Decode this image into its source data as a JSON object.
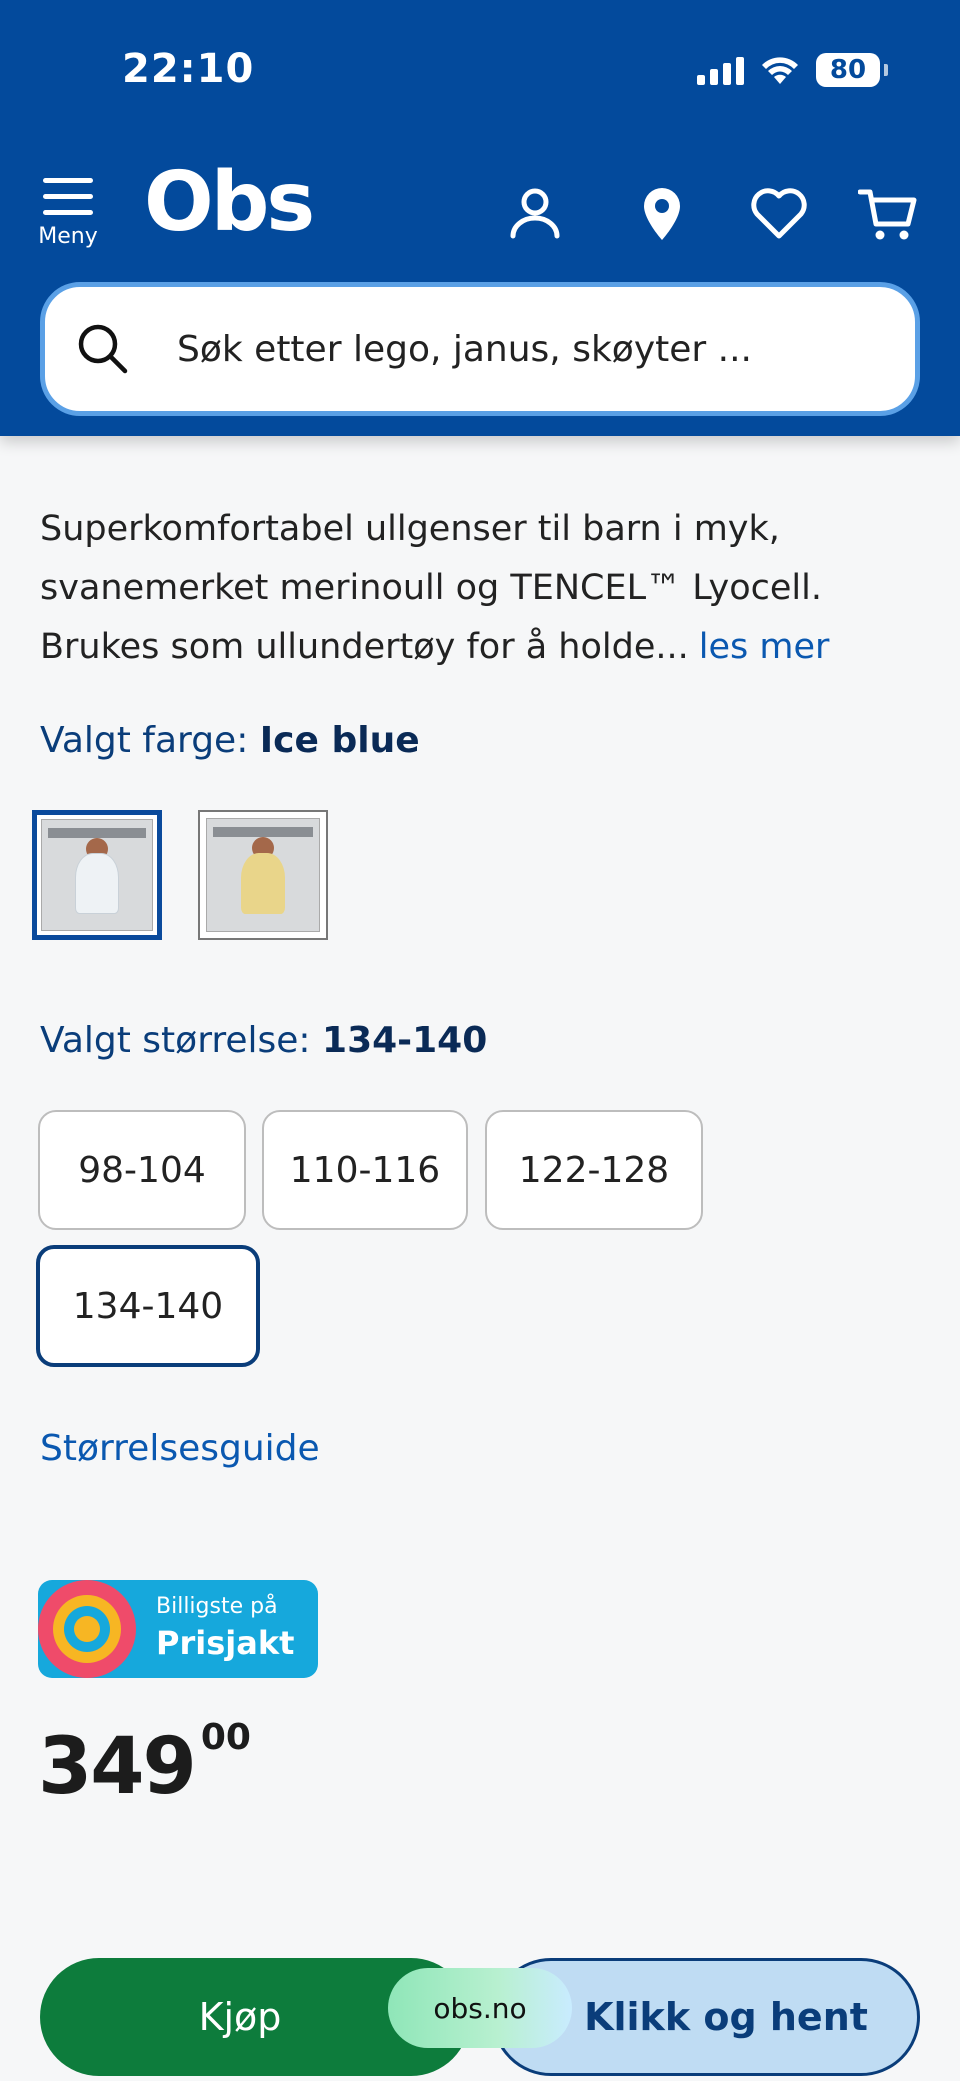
{
  "status_bar": {
    "time": "22:10",
    "battery": "80"
  },
  "header": {
    "menu_label": "Meny",
    "logo_text": "Obs",
    "search_placeholder": "Søk etter lego, janus, skøyter ..."
  },
  "product": {
    "description": "Superkomfortabel ullgenser til barn i myk, svanemerket merinoull og TENCEL™ Lyocell. Brukes som ullundertøy for å holde...",
    "read_more": "les mer",
    "color_prefix": "Valgt farge: ",
    "color_value": "Ice blue",
    "swatches": [
      {
        "name": "Ice blue",
        "color": "#e6ecf1"
      },
      {
        "name": "Yellow",
        "color": "#e9d58a"
      }
    ],
    "size_prefix": "Valgt størrelse: ",
    "size_value": "134-140",
    "sizes": [
      "98-104",
      "110-116",
      "122-128",
      "134-140"
    ],
    "selected_size": "134-140",
    "size_guide": "Størrelsesguide",
    "prisjakt_small": "Billigste på",
    "prisjakt_big": "Prisjakt",
    "price_main": "349",
    "price_cents": "00"
  },
  "actions": {
    "buy": "Kjøp",
    "click_collect": "Klikk og hent",
    "domain": "obs.no"
  },
  "colors": {
    "brand_blue": "#034a9c",
    "buy_green": "#0d7c3c",
    "link_blue": "#0a58b0",
    "prisjakt_cyan": "#16a8dc"
  }
}
